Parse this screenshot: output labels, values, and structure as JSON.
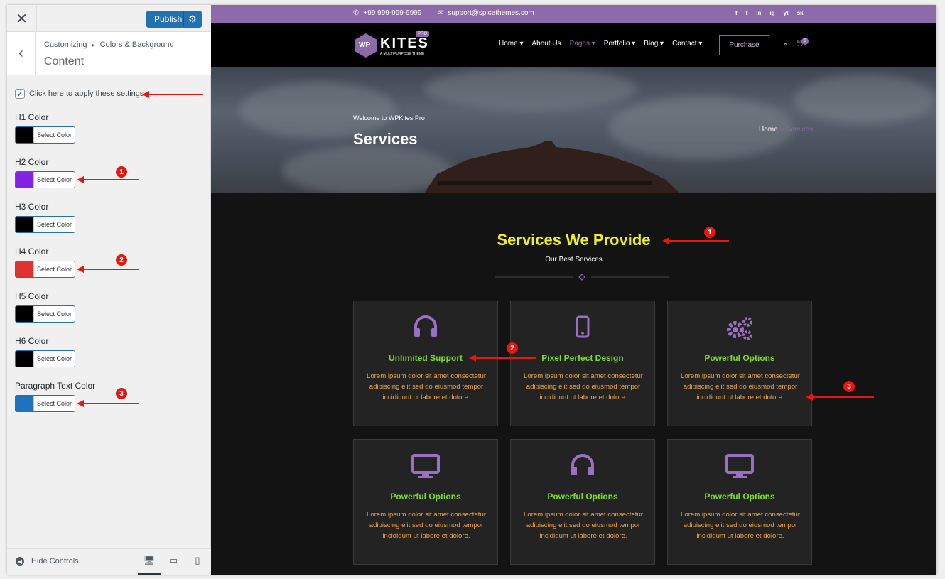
{
  "topbar": {
    "close_label": "✕",
    "publish_label": "Publish",
    "gear_icon": "gear-icon"
  },
  "section": {
    "breadcrumb_root": "Customizing",
    "breadcrumb_separator": "▸",
    "breadcrumb_parent": "Colors & Background",
    "title": "Content"
  },
  "apply_checkbox": {
    "label": "Click here to apply these settings",
    "checked": true
  },
  "color_controls": [
    {
      "label": "H1 Color",
      "color": "#000000",
      "button": "Select Color"
    },
    {
      "label": "H2 Color",
      "color": "#8224e3",
      "button": "Select Color"
    },
    {
      "label": "H3 Color",
      "color": "#000000",
      "button": "Select Color"
    },
    {
      "label": "H4 Color",
      "color": "#dd3333",
      "button": "Select Color"
    },
    {
      "label": "H5 Color",
      "color": "#000000",
      "button": "Select Color"
    },
    {
      "label": "H6 Color",
      "color": "#000000",
      "button": "Select Color"
    },
    {
      "label": "Paragraph Text Color",
      "color": "#1e73be",
      "button": "Select Color"
    }
  ],
  "footer": {
    "hide_controls": "Hide Controls"
  },
  "annotations": {
    "badge1": "1",
    "badge2": "2",
    "badge3": "3"
  },
  "preview": {
    "phone": "+99 999-999-9999",
    "email": "support@spicethemes.com",
    "social": [
      "f",
      "t",
      "in",
      "ig",
      "yt",
      "sk"
    ],
    "logo_mark": "WP",
    "logo_word": "KITES",
    "logo_pro": "PRO",
    "logo_tag": "A MULTIPURPOSE THEME",
    "menu": [
      "Home ▾",
      "About Us",
      "Pages ▾",
      "Portfolio ▾",
      "Blog ▾",
      "Contact ▾"
    ],
    "purchase": "Purchase",
    "cart_count": "0",
    "hero_welcome": "Welcome to WPKites Pro",
    "hero_title": "Services",
    "crumb_home": "Home",
    "crumb_sep": "»",
    "crumb_current": "Services",
    "services_title": "Services We Provide",
    "services_sub": "Our Best Services",
    "accent": "#8e6aab",
    "cards": [
      {
        "icon": "headphones-icon",
        "title": "Unlimited Support",
        "text": "Lorem ipsum dolor sit amet consectetur adipiscing elit sed do eiusmod tempor incididunt ut labore et dolore."
      },
      {
        "icon": "mobile-icon",
        "title": "Pixel Perfect Design",
        "text": "Lorem ipsum dolor sit amet consectetur adipiscing elit sed do eiusmod tempor incididunt ut labore et dolore."
      },
      {
        "icon": "cogs-icon",
        "title": "Powerful Options",
        "text": "Lorem ipsum dolor sit amet consectetur adipiscing elit sed do eiusmod tempor incididunt ut labore et dolore."
      },
      {
        "icon": "monitor-icon",
        "title": "Powerful Options",
        "text": "Lorem ipsum dolor sit amet consectetur adipiscing elit sed do eiusmod tempor incididunt ut labore et dolore."
      },
      {
        "icon": "headphones-icon",
        "title": "Powerful Options",
        "text": "Lorem ipsum dolor sit amet consectetur adipiscing elit sed do eiusmod tempor incididunt ut labore et dolore."
      },
      {
        "icon": "monitor-icon",
        "title": "Powerful Options",
        "text": "Lorem ipsum dolor sit amet consectetur adipiscing elit sed do eiusmod tempor incididunt ut labore et dolore."
      }
    ]
  }
}
